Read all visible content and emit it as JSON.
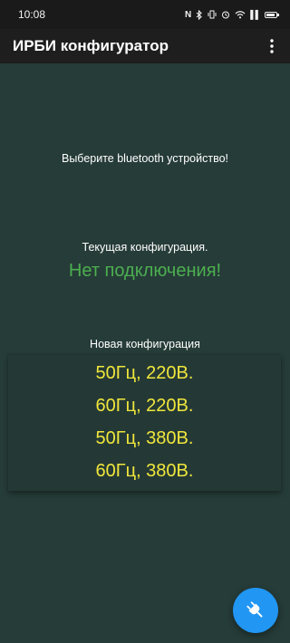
{
  "status_bar": {
    "time": "10:08",
    "icons": [
      "nfc-icon",
      "bluetooth-icon",
      "vibrate-icon",
      "alarm-icon",
      "wifi-icon",
      "signal-icon",
      "battery-icon"
    ],
    "nfc_glyph": "N",
    "signal_glyph": "▌▌"
  },
  "app_bar": {
    "title": "ИРБИ конфигуратор",
    "menu_icon": "more-vert-icon"
  },
  "main": {
    "prompt": "Выберите bluetooth устройство!",
    "current_label": "Текущая конфигурация.",
    "current_value": "Нет подключения!",
    "new_label": "Новая конфигурация",
    "options": [
      {
        "label": "50Гц, 220В."
      },
      {
        "label": "60Гц, 220В."
      },
      {
        "label": "50Гц, 380В."
      },
      {
        "label": "60Гц, 380В."
      }
    ]
  },
  "fab": {
    "icon": "bluetooth-connect-icon"
  },
  "colors": {
    "background": "#263c38",
    "status_ok": "#4caf50",
    "option_text": "#f0e63c",
    "fab": "#2196f3"
  }
}
